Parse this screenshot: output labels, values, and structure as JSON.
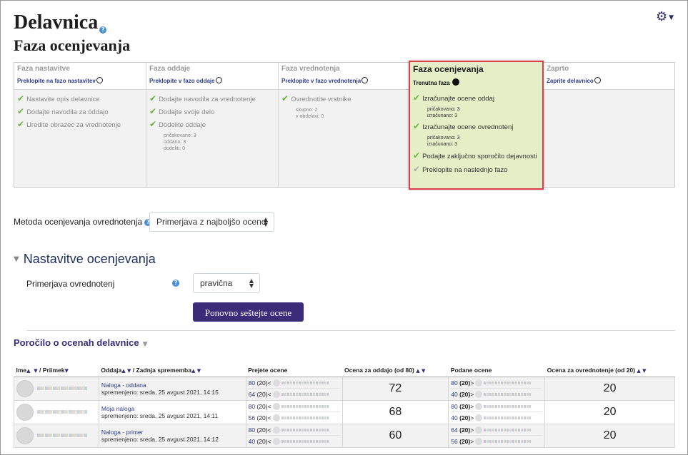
{
  "page": {
    "title": "Delavnica",
    "subtitle": "Faza ocenjevanja"
  },
  "phases": [
    {
      "title": "Faza nastavitve",
      "switch": "Preklopite na fazo nastavitev",
      "tasks": [
        {
          "label": "Nastavite opis delavnice",
          "sub": []
        },
        {
          "label": "Dodajte navodila za oddajo",
          "sub": []
        },
        {
          "label": "Uredite obrazec za vrednotenje",
          "sub": []
        }
      ]
    },
    {
      "title": "Faza oddaje",
      "switch": "Preklopite v fazo oddaje",
      "tasks": [
        {
          "label": "Dodajte navodila za vrednotenje",
          "sub": []
        },
        {
          "label": "Dodajte svoje delo",
          "sub": []
        },
        {
          "label": "Dodelite oddaje",
          "sub": [
            "pričakovano: 3",
            "oddano: 3",
            "dodeliti: 0"
          ]
        }
      ]
    },
    {
      "title": "Faza vrednotenja",
      "switch": "Preklopite v fazo vrednotenja",
      "tasks": [
        {
          "label": "Ovrednotite vrstnike",
          "sub": [
            "skupno: 2",
            "v obdelavi: 0"
          ]
        }
      ]
    },
    {
      "title": "Faza ocenjevanja",
      "switch": "Trenutna faza",
      "tasks": [
        {
          "label": "Izračunajte ocene oddaj",
          "sub": [
            "pričakovano: 3",
            "izračunano: 3"
          ]
        },
        {
          "label": "Izračunajte ocene ovrednotenj",
          "sub": [
            "pričakovano: 3",
            "izračunano: 3"
          ]
        },
        {
          "label": "Podajte zaključno sporočilo dejavnosti",
          "sub": []
        },
        {
          "label": "Preklopite na naslednjo fazo",
          "sub": []
        }
      ]
    },
    {
      "title": "Zaprto",
      "switch": "Zaprite delavnico",
      "tasks": []
    }
  ],
  "comparison": {
    "label": "Metoda ocenjevanja ovrednotenja",
    "value": "Primerjava z najboljšo oceno"
  },
  "settings": {
    "title": "Nastavitve ocenjevanja",
    "field_label": "Primerjava ovrednotenj",
    "field_value": "pravična",
    "button": "Ponovno seštejte ocene"
  },
  "report": {
    "title": "Poročilo o ocenah delavnice",
    "headers": {
      "name": "Ime",
      "surname": "/ Priimek",
      "submission": "Oddaja",
      "modified": "/ Zadnja sprememba",
      "received": "Prejete ocene",
      "grade_submission": "Ocena za oddajo (od 80)",
      "given": "Podane ocene",
      "grade_assessment": "Ocena za ovrednotenje (od 20)"
    },
    "rows": [
      {
        "submission": "Naloga - oddana",
        "modified": "spremenjeno: sreda, 25 avgust 2021, 14:15",
        "received": [
          {
            "grade": "80",
            "weight": "(20)",
            "dir": "<"
          },
          {
            "grade": "64",
            "weight": "(20)",
            "dir": "<"
          }
        ],
        "grade_submission": "72",
        "given": [
          {
            "grade": "80",
            "weight": "(20)",
            "dir": ">"
          },
          {
            "grade": "40",
            "weight": "(20)",
            "dir": ">"
          }
        ],
        "grade_assessment": "20"
      },
      {
        "submission": "Moja naloga",
        "modified": "spremenjeno: sreda, 25 avgust 2021, 14:11",
        "received": [
          {
            "grade": "80",
            "weight": "(20)",
            "dir": "<"
          },
          {
            "grade": "56",
            "weight": "(20)",
            "dir": "<"
          }
        ],
        "grade_submission": "68",
        "given": [
          {
            "grade": "80",
            "weight": "(20)",
            "dir": ">"
          },
          {
            "grade": "40",
            "weight": "(20)",
            "dir": ">"
          }
        ],
        "grade_assessment": "20"
      },
      {
        "submission": "Naloga - primer",
        "modified": "spremenjeno: sreda, 25 avgust 2021, 14:12",
        "received": [
          {
            "grade": "80",
            "weight": "(20)",
            "dir": "<"
          },
          {
            "grade": "40",
            "weight": "(20)",
            "dir": "<"
          }
        ],
        "grade_submission": "60",
        "given": [
          {
            "grade": "64",
            "weight": "(20)",
            "dir": ">"
          },
          {
            "grade": "56",
            "weight": "(20)",
            "dir": ">"
          }
        ],
        "grade_assessment": "20"
      }
    ]
  },
  "colors": {
    "accent": "#3a2c78",
    "active_phase_bg": "#e5efc7",
    "highlight_border": "#e03d4b",
    "check": "#6cb33f"
  }
}
